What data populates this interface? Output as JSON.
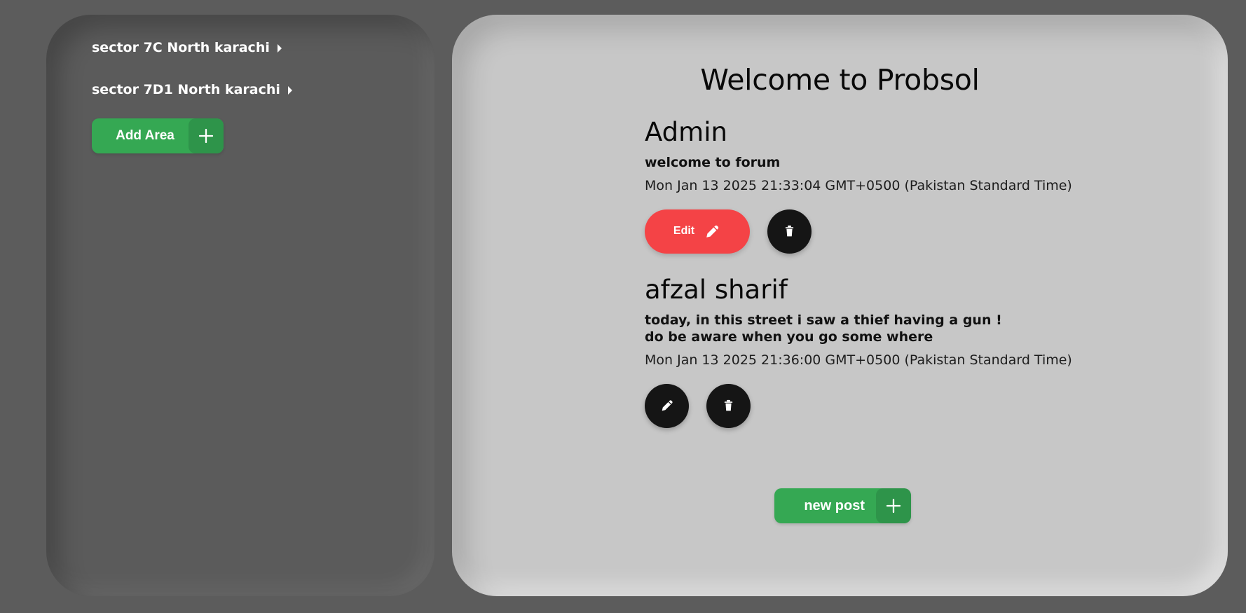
{
  "sidebar": {
    "areas": [
      {
        "label": "sector 7C North karachi"
      },
      {
        "label": "sector 7D1 North karachi"
      }
    ],
    "add_area_label": "Add Area"
  },
  "main": {
    "title": "Welcome to Probsol",
    "posts": [
      {
        "author": "Admin",
        "body": "welcome to forum",
        "date": "Mon Jan 13 2025 21:33:04 GMT+0500 (Pakistan Standard Time)",
        "edit_label": "Edit"
      },
      {
        "author": "afzal sharif",
        "body": "today, in this street i saw a thief having a gun !\ndo be aware when you go some where",
        "date": "Mon Jan 13 2025 21:36:00 GMT+0500 (Pakistan Standard Time)"
      }
    ],
    "new_post_label": "new post"
  },
  "icons": {
    "area_caret": "caret-right-icon",
    "add": "plus-icon",
    "edit": "pencil-icon",
    "delete": "trash-icon"
  },
  "colors": {
    "background": "#5c5c5c",
    "sidebar": "#5b5b5b",
    "main_panel": "#c7c7c7",
    "accent_green": "#35a853",
    "edit_red": "#f44346",
    "dark_button": "#151515"
  }
}
